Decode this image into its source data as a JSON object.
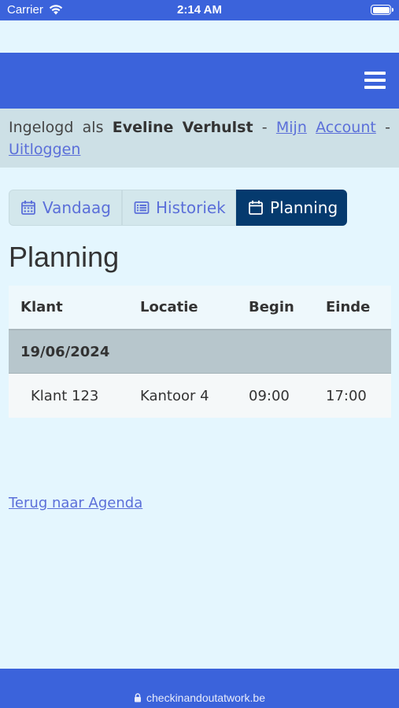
{
  "status_bar": {
    "carrier": "Carrier",
    "time": "2:14 AM"
  },
  "colors": {
    "brand_blue": "#3b63db",
    "active_tab": "#053a6e",
    "link": "#5b6fd9",
    "page_bg": "#e4f6fe"
  },
  "login": {
    "prefix_1": "Ingelogd",
    "prefix_2": "als",
    "user_first": "Eveline",
    "user_last": "Verhulst",
    "sep": "-",
    "account_1": "Mijn",
    "account_2": "Account",
    "logout": "Uitloggen"
  },
  "tabs": [
    {
      "label": "Vandaag",
      "icon": "calendar-grid-icon",
      "active": false
    },
    {
      "label": "Historiek",
      "icon": "list-icon",
      "active": false
    },
    {
      "label": "Planning",
      "icon": "calendar-icon",
      "active": true
    }
  ],
  "page_title": "Planning",
  "table": {
    "headers": [
      "Klant",
      "Locatie",
      "Begin",
      "Einde"
    ],
    "date": "19/06/2024",
    "rows": [
      [
        "Klant 123",
        "Kantoor 4",
        "09:00",
        "17:00"
      ]
    ]
  },
  "back_link": "Terug naar Agenda",
  "url": "checkinandoutatwork.be"
}
